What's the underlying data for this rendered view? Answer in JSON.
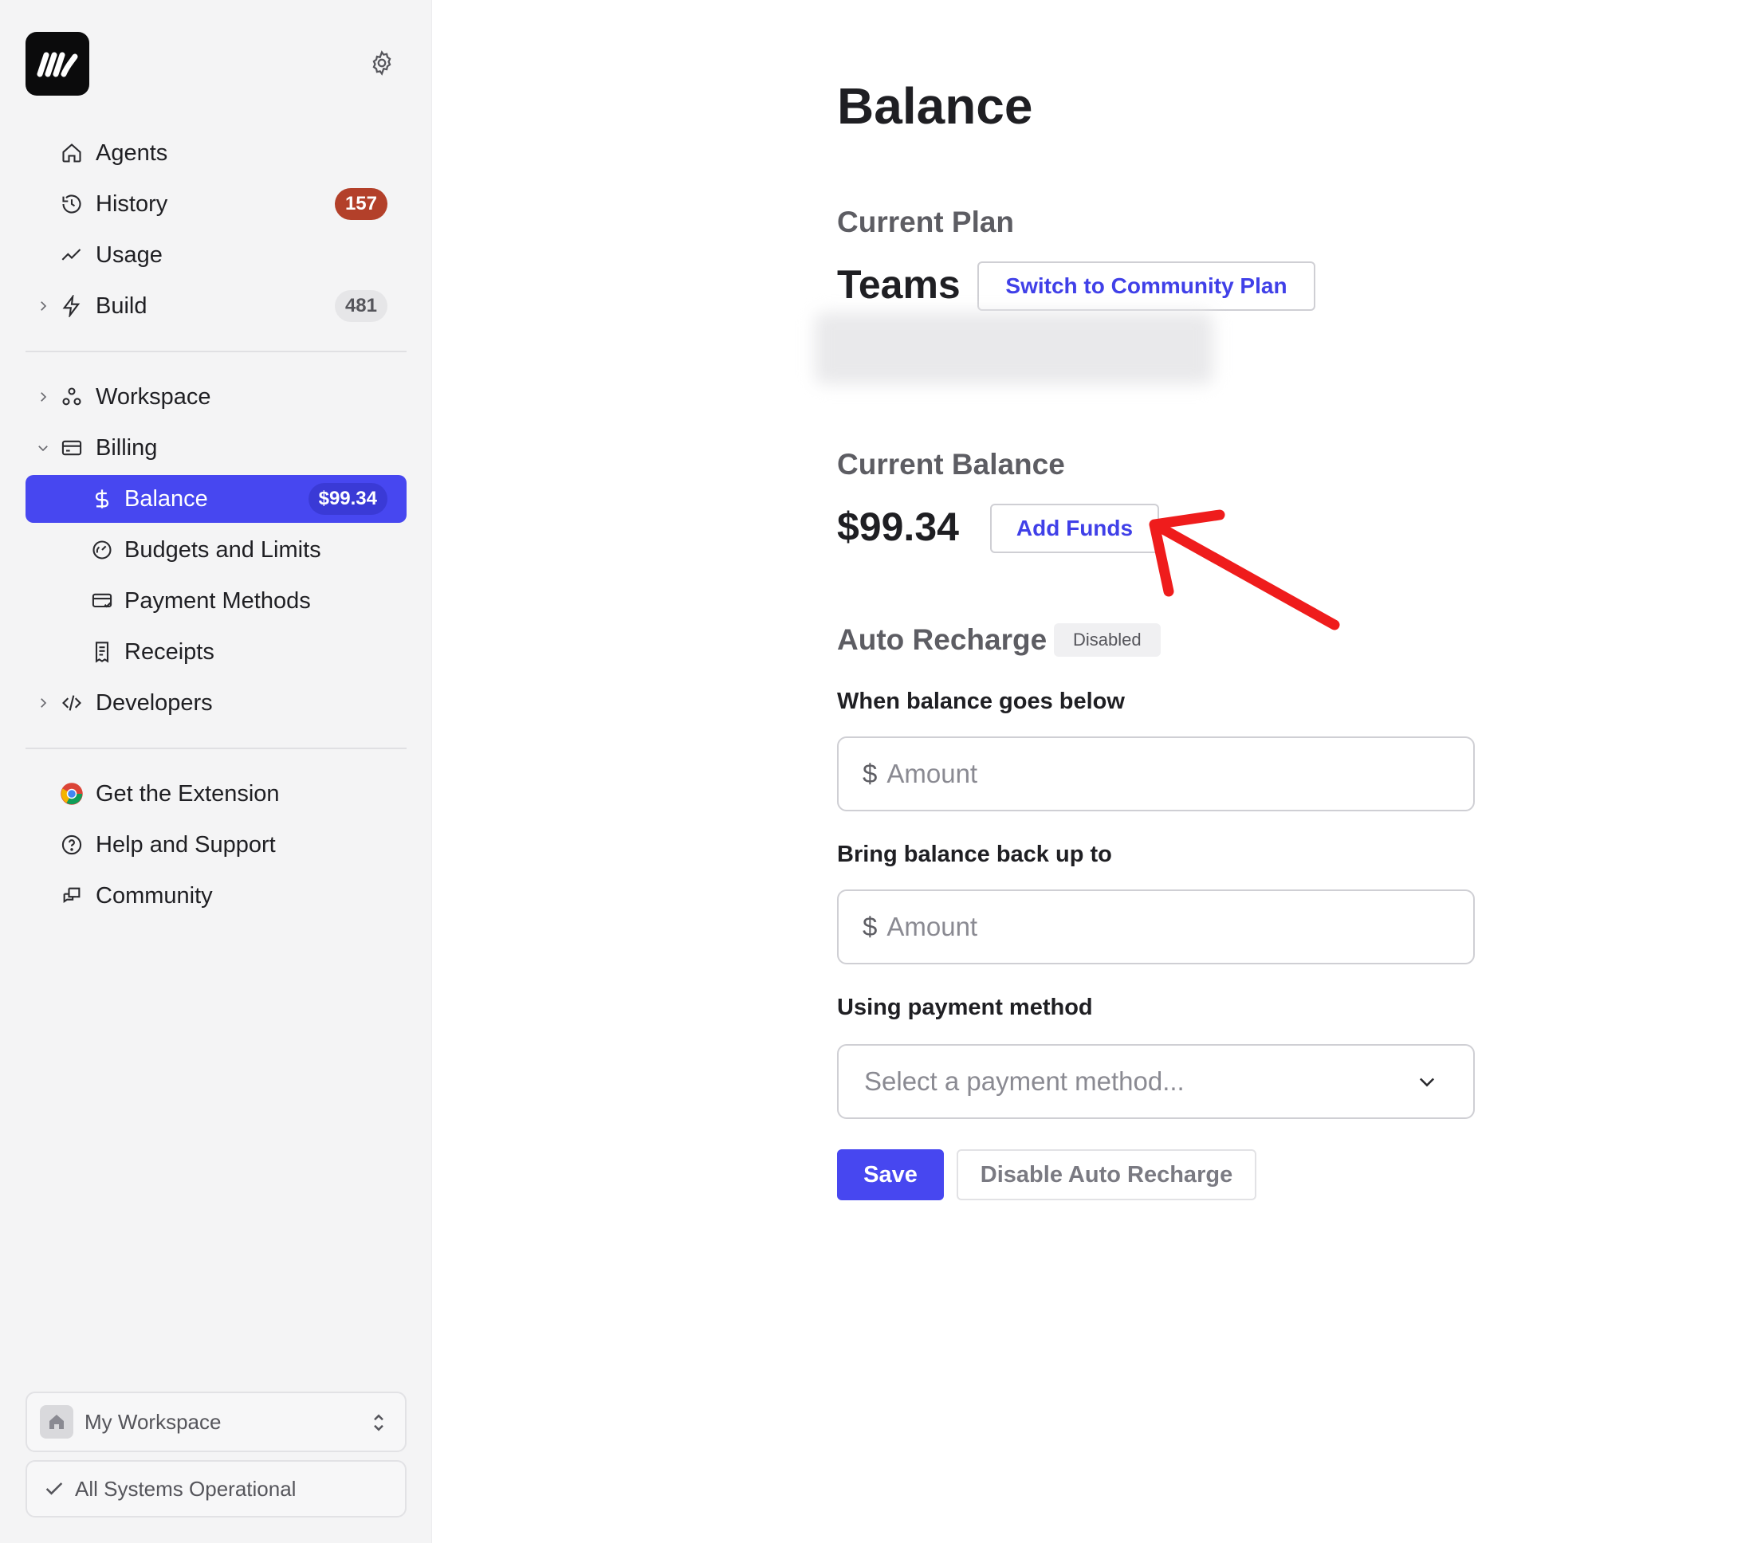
{
  "sidebar": {
    "nav_primary": [
      {
        "label": "Agents"
      },
      {
        "label": "History",
        "badge": "157"
      },
      {
        "label": "Usage"
      },
      {
        "label": "Build",
        "badge": "481"
      }
    ],
    "nav_secondary": [
      {
        "label": "Workspace"
      },
      {
        "label": "Billing"
      },
      {
        "label": "Balance",
        "badge": "$99.34"
      },
      {
        "label": "Budgets and Limits"
      },
      {
        "label": "Payment Methods"
      },
      {
        "label": "Receipts"
      },
      {
        "label": "Developers"
      }
    ],
    "nav_tertiary": [
      {
        "label": "Get the Extension"
      },
      {
        "label": "Help and Support"
      },
      {
        "label": "Community"
      }
    ],
    "workspace_switcher": "My Workspace",
    "system_status": "All Systems Operational"
  },
  "main": {
    "title": "Balance",
    "plan": {
      "heading": "Current Plan",
      "name": "Teams",
      "switch_button": "Switch to Community Plan"
    },
    "balance": {
      "heading": "Current Balance",
      "amount": "$99.34",
      "add_funds_button": "Add Funds"
    },
    "auto_recharge": {
      "heading": "Auto Recharge",
      "status": "Disabled",
      "threshold_label": "When balance goes below",
      "threshold_prefix": "$",
      "threshold_placeholder": "Amount",
      "target_label": "Bring balance back up to",
      "target_prefix": "$",
      "target_placeholder": "Amount",
      "payment_label": "Using payment method",
      "payment_placeholder": "Select a payment method...",
      "save_button": "Save",
      "disable_button": "Disable Auto Recharge"
    }
  },
  "colors": {
    "accent": "#4747f0",
    "history_badge": "#b3402a",
    "annotation_arrow": "#ef1c1c"
  }
}
